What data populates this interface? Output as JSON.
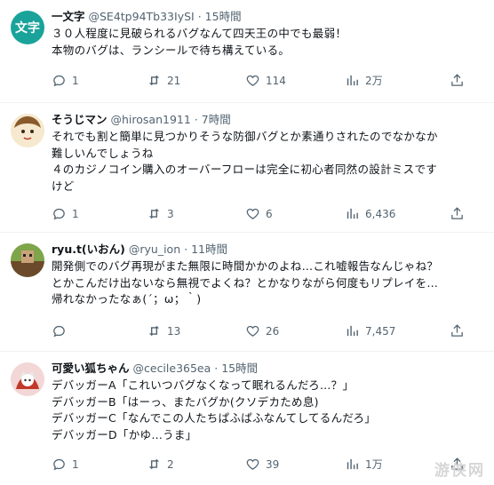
{
  "tweets": [
    {
      "name": "一文字",
      "handle": "@SE4tp94Tb33IySI",
      "sep": "·",
      "time": "15時間",
      "avatar_text": "文字",
      "lines": [
        "３０人程度に見破られるバグなんて四天王の中でも最弱！",
        "本物のバグは、ランシールで待ち構えている。"
      ],
      "replies": "1",
      "retweets": "21",
      "likes": "114",
      "views": "2万"
    },
    {
      "name": "そうじマン",
      "handle": "@hirosan1911",
      "sep": "·",
      "time": "7時間",
      "lines": [
        "それでも割と簡単に見つかりそうな防御バグとか素通りされたのでなかなか",
        "難しいんでしょうね",
        "４のカジノコイン購入のオーバーフローは完全に初心者同然の設計ミスです",
        "けど"
      ],
      "replies": "1",
      "retweets": "3",
      "likes": "6",
      "views": "6,436"
    },
    {
      "name": "ryu.t(いおん)",
      "handle": "@ryu_ion",
      "sep": "·",
      "time": "11時間",
      "lines": [
        "開発側でのバグ再現がまた無限に時間かかのよね…これ嘘報告なんじゃね？",
        "とかこんだけ出ないなら無視でよくね？とかなりながら何度もリプレイを…",
        "帰れなかったなぁ(´；ω；｀)"
      ],
      "replies": "",
      "retweets": "13",
      "likes": "26",
      "views": "7,457"
    },
    {
      "name": "可愛い狐ちゃん",
      "handle": "@cecile365ea",
      "sep": "·",
      "time": "15時間",
      "lines": [
        "デバッガーA「これいつバグなくなって眠れるんだろ…？」",
        "デバッガーB「はーっ、またバグか(クソデカため息)",
        "デバッガーC「なんでこの人たちぱふぱふなんてしてるんだろ」",
        "デバッガーD「かゆ…うま」"
      ],
      "replies": "1",
      "retweets": "2",
      "likes": "39",
      "views": "1万"
    }
  ],
  "watermark": "游侠网",
  "colors": {
    "text": "#0f1419",
    "muted": "#536471",
    "border": "#eff3f4",
    "avatar1": "#1aa39a"
  }
}
